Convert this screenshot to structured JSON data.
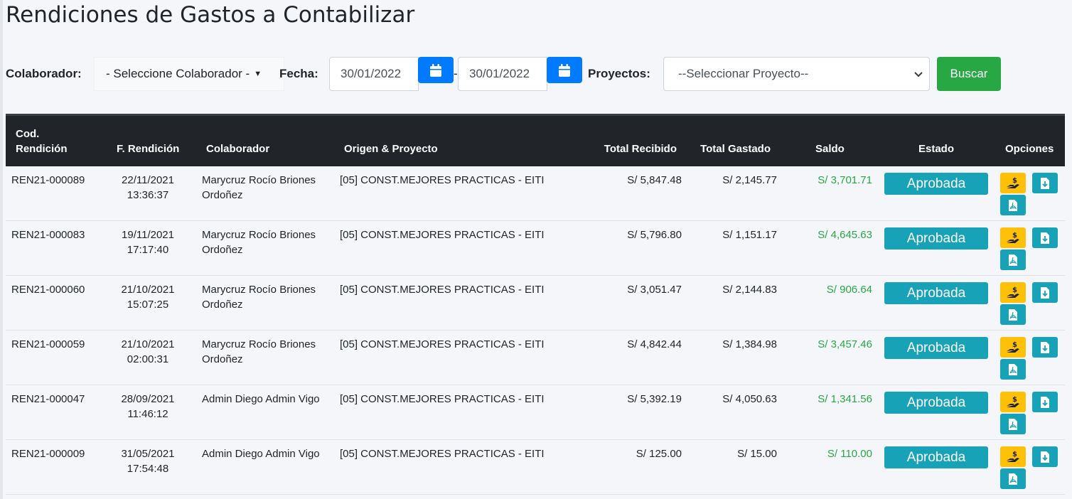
{
  "page": {
    "title": "Rendiciones de Gastos a Contabilizar"
  },
  "filters": {
    "colaborador_label": "Colaborador:",
    "colaborador_value": "- Seleccione Colaborador -",
    "fecha_label": "Fecha:",
    "fecha_desde": "30/01/2022",
    "fecha_separator": "-",
    "fecha_hasta": "30/01/2022",
    "proyectos_label": "Proyectos:",
    "proyecto_value": "--Seleccionar Proyecto--",
    "buscar_label": "Buscar"
  },
  "table": {
    "headers": {
      "cod_line1": "Cod.",
      "cod_line2": "Rendición",
      "fecha": "F. Rendición",
      "colaborador": "Colaborador",
      "origen": "Origen & Proyecto",
      "recibido": "Total Recibido",
      "gastado": "Total Gastado",
      "saldo": "Saldo",
      "estado": "Estado",
      "opciones": "Opciones"
    },
    "rows": [
      {
        "cod": "REN21-000089",
        "fecha": "22/11/2021",
        "hora": "13:36:37",
        "colab1": "Marycruz Rocío Briones",
        "colab2": "Ordoñez",
        "origen": "[05] CONST.MEJORES PRACTICAS - EITI",
        "recibido": "S/ 5,847.48",
        "gastado": "S/ 2,145.77",
        "saldo": "S/ 3,701.71",
        "estado": "Aprobada"
      },
      {
        "cod": "REN21-000083",
        "fecha": "19/11/2021",
        "hora": "17:17:40",
        "colab1": "Marycruz Rocío Briones",
        "colab2": "Ordoñez",
        "origen": "[05] CONST.MEJORES PRACTICAS - EITI",
        "recibido": "S/ 5,796.80",
        "gastado": "S/ 1,151.17",
        "saldo": "S/ 4,645.63",
        "estado": "Aprobada"
      },
      {
        "cod": "REN21-000060",
        "fecha": "21/10/2021",
        "hora": "15:07:25",
        "colab1": "Marycruz Rocío Briones",
        "colab2": "Ordoñez",
        "origen": "[05] CONST.MEJORES PRACTICAS - EITI",
        "recibido": "S/ 3,051.47",
        "gastado": "S/ 2,144.83",
        "saldo": "S/ 906.64",
        "estado": "Aprobada"
      },
      {
        "cod": "REN21-000059",
        "fecha": "21/10/2021",
        "hora": "02:00:31",
        "colab1": "Marycruz Rocío Briones",
        "colab2": "Ordoñez",
        "origen": "[05] CONST.MEJORES PRACTICAS - EITI",
        "recibido": "S/ 4,842.44",
        "gastado": "S/ 1,384.98",
        "saldo": "S/ 3,457.46",
        "estado": "Aprobada"
      },
      {
        "cod": "REN21-000047",
        "fecha": "28/09/2021",
        "hora": "11:46:12",
        "colab1": "Admin Diego Admin Vigo",
        "colab2": "",
        "origen": "[05] CONST.MEJORES PRACTICAS - EITI",
        "recibido": "S/ 5,392.19",
        "gastado": "S/ 4,050.63",
        "saldo": "S/ 1,341.56",
        "estado": "Aprobada"
      },
      {
        "cod": "REN21-000009",
        "fecha": "31/05/2021",
        "hora": "17:54:48",
        "colab1": "Admin Diego Admin Vigo",
        "colab2": "",
        "origen": "[05] CONST.MEJORES PRACTICAS - EITI",
        "recibido": "S/ 125.00",
        "gastado": "S/ 15.00",
        "saldo": "S/ 110.00",
        "estado": "Aprobada"
      }
    ]
  },
  "icons": {
    "calendar": "calendar-icon",
    "chevron": "chevron-down-icon",
    "pay": "hand-money-icon",
    "download": "file-download-icon",
    "pdf": "pdf-file-icon"
  },
  "colors": {
    "header_bg": "#212529",
    "primary": "#007bff",
    "success": "#28a745",
    "info": "#17a2b8",
    "warning": "#ffc107"
  }
}
